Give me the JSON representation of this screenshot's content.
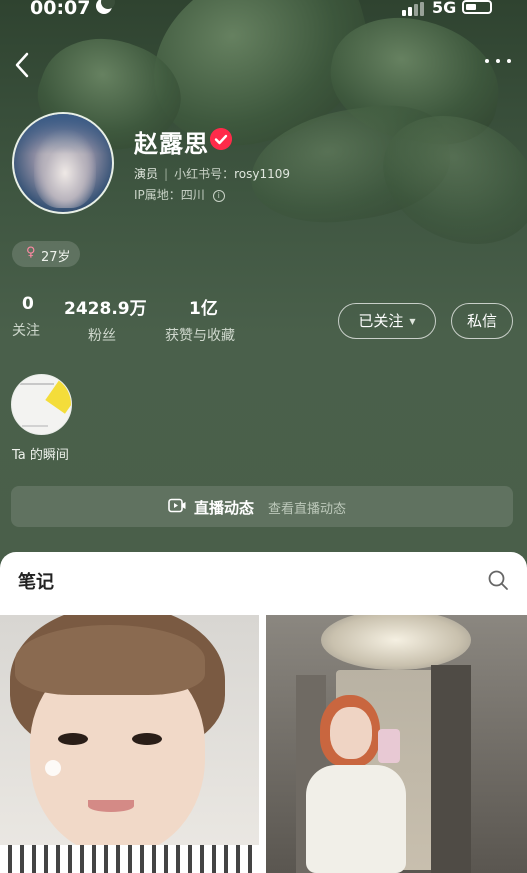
{
  "status_bar": {
    "time": "00:07",
    "network": "5G"
  },
  "profile": {
    "name": "赵露思",
    "role": "演员",
    "id_label": "小红书号：",
    "id_value": "rosy1109",
    "ip_label": "IP属地：",
    "ip_value": "四川",
    "gender_symbol": "♀",
    "age": "27岁"
  },
  "stats": [
    {
      "value": "0",
      "label": "关注"
    },
    {
      "value": "2428.9万",
      "label": "粉丝"
    },
    {
      "value": "1亿",
      "label": "获赞与收藏"
    }
  ],
  "actions": {
    "follow_label": "已关注",
    "message_label": "私信"
  },
  "moment": {
    "label": "Ta 的瞬间"
  },
  "live": {
    "title": "直播动态",
    "subtitle": "查看直播动态"
  },
  "notes": {
    "title": "笔记"
  },
  "colors": {
    "verified": "#ff2b4a",
    "header_bg": "#445a45"
  },
  "icons": [
    "back-icon",
    "more-icon",
    "verified-icon",
    "info-icon",
    "live-icon",
    "search-icon"
  ]
}
